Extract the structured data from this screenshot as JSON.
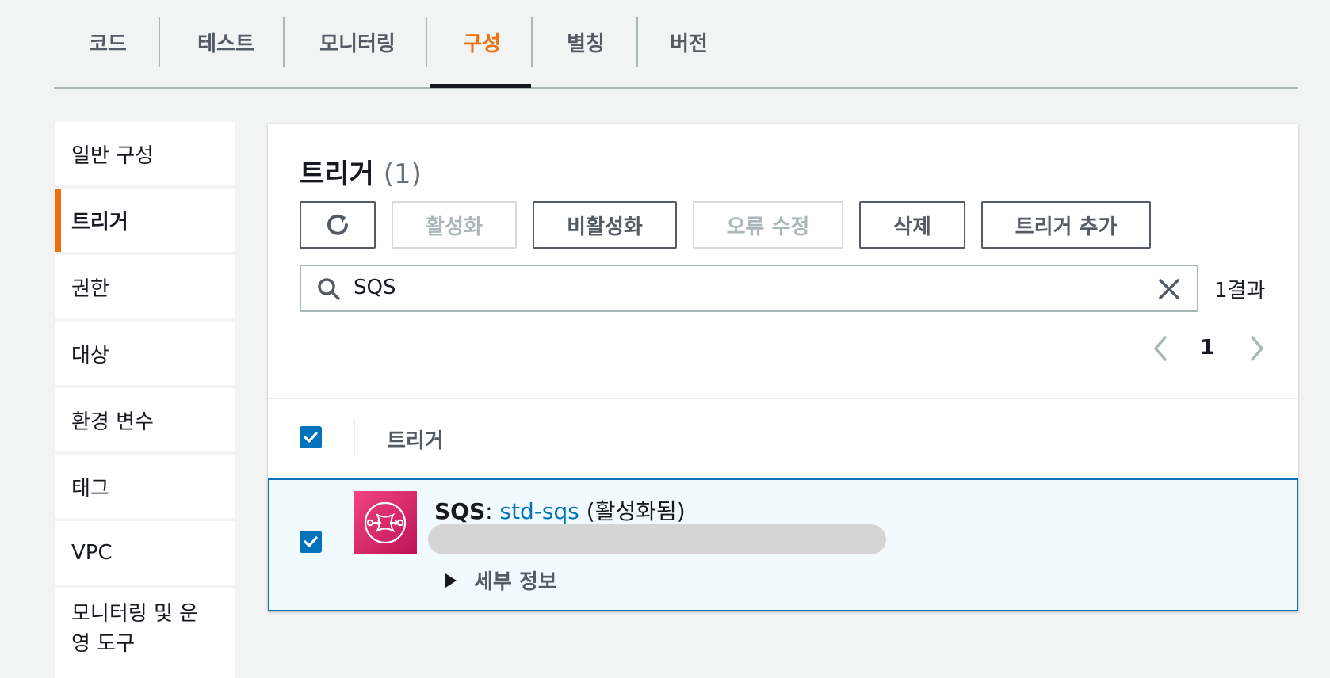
{
  "tabs": [
    {
      "label": "코드",
      "active": false
    },
    {
      "label": "테스트",
      "active": false
    },
    {
      "label": "모니터링",
      "active": false
    },
    {
      "label": "구성",
      "active": true
    },
    {
      "label": "별칭",
      "active": false
    },
    {
      "label": "버전",
      "active": false
    }
  ],
  "sidebar": {
    "items": [
      {
        "label": "일반 구성"
      },
      {
        "label": "트리거",
        "active": true
      },
      {
        "label": "권한"
      },
      {
        "label": "대상"
      },
      {
        "label": "환경 변수"
      },
      {
        "label": "태그"
      },
      {
        "label": "VPC"
      },
      {
        "label": "모니터링 및 운영 도구"
      }
    ]
  },
  "panel": {
    "title": "트리거",
    "count": "(1)",
    "buttons": {
      "refresh_icon": "refresh-icon",
      "enable": "활성화",
      "disable": "비활성화",
      "fix_errors": "오류 수정",
      "delete": "삭제",
      "add_trigger": "트리거 추가"
    },
    "search": {
      "value": "SQS",
      "icon": "search-icon",
      "clear_icon": "close-icon"
    },
    "result_count": "1결과",
    "pagination": {
      "page": "1"
    },
    "table": {
      "column_header": "트리거",
      "rows": [
        {
          "checked": true,
          "service": "SQS",
          "separator": ":",
          "resource": "std-sqs",
          "status": "(활성화됨)",
          "details_label": "세부 정보"
        }
      ]
    }
  },
  "colors": {
    "accent": "#ec7211",
    "link": "#0073bb",
    "sqs_brand": "#e7157b"
  }
}
